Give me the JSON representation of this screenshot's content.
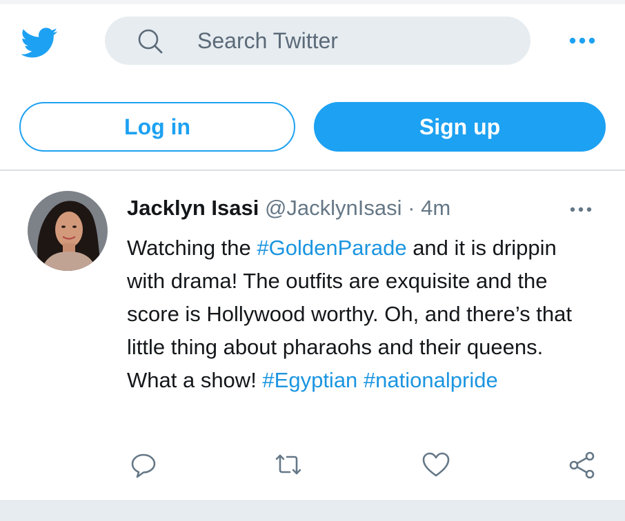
{
  "colors": {
    "brand_blue": "#1da1f2",
    "hashtag_blue": "#1b95e0",
    "muted_text": "#657786",
    "search_bg": "#e6ecf0"
  },
  "header": {
    "logo_icon": "twitter-bird-icon",
    "search": {
      "icon": "search-icon",
      "placeholder": "Search Twitter",
      "value": ""
    },
    "more_icon": "more-horizontal-icon"
  },
  "auth": {
    "login_label": "Log in",
    "signup_label": "Sign up"
  },
  "tweet": {
    "author_name": "Jacklyn Isasi",
    "author_handle": "@JacklynIsasi",
    "separator": "·",
    "time": "4m",
    "text": {
      "part1": "Watching the ",
      "hashtag1": "#GoldenParade",
      "part2": " and it is drippin with drama! The outfits are exquisite and the score is Hollywood worthy. Oh, and there’s that little thing about pharaohs and their queens. What a show! ",
      "hashtag2": "#Egyptian",
      "part3": " ",
      "hashtag3": "#nationalpride"
    },
    "more_icon": "more-horizontal-icon",
    "actions": [
      "reply-icon",
      "retweet-icon",
      "like-icon",
      "share-icon"
    ]
  }
}
